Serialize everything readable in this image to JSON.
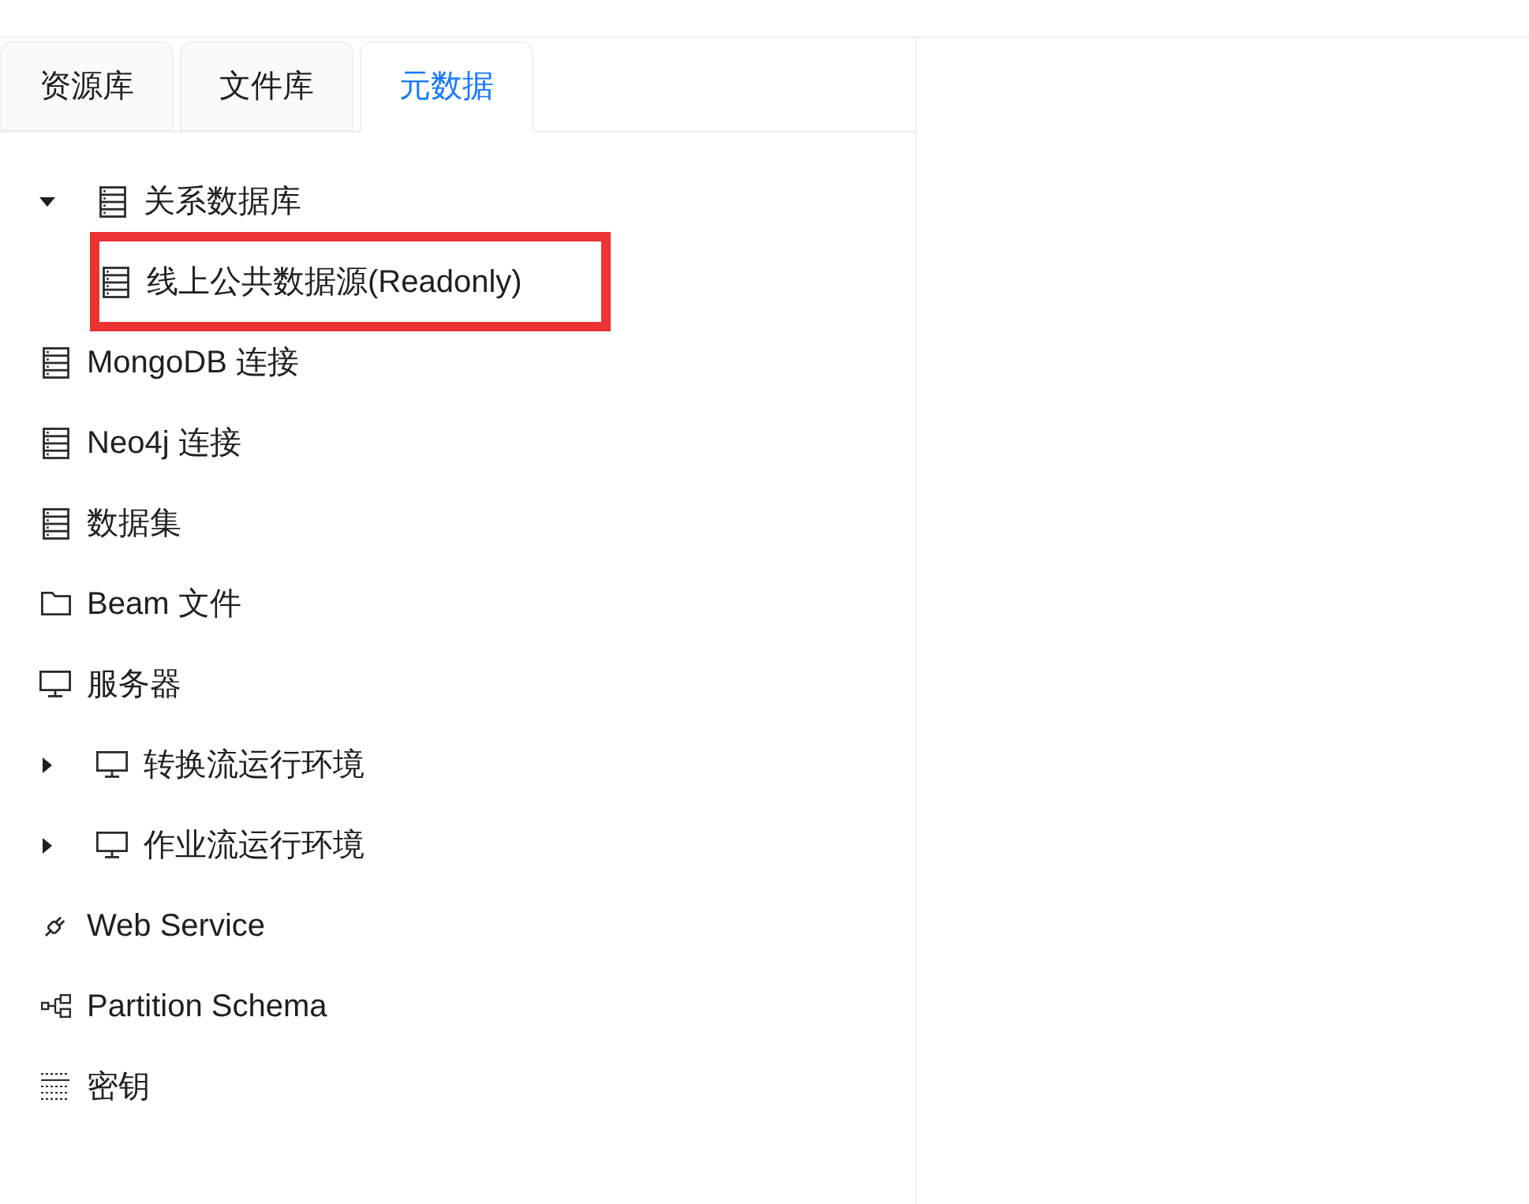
{
  "tabs": [
    {
      "label": "资源库",
      "selected": false
    },
    {
      "label": "文件库",
      "selected": false
    },
    {
      "label": "元数据",
      "selected": true
    }
  ],
  "tree": [
    {
      "label": "关系数据库",
      "kind": "database",
      "expanded": true,
      "annotated": false,
      "children": [
        {
          "label": "线上公共数据源(Readonly)",
          "kind": "database",
          "annotated": true
        }
      ]
    },
    {
      "label": "MongoDB 连接",
      "kind": "database",
      "annotated": false
    },
    {
      "label": "Neo4j 连接",
      "kind": "database",
      "annotated": false
    },
    {
      "label": "数据集",
      "kind": "database",
      "annotated": false
    },
    {
      "label": "Beam 文件",
      "kind": "folder",
      "annotated": false
    },
    {
      "label": "服务器",
      "kind": "server",
      "annotated": false
    },
    {
      "label": "转换流运行环境",
      "kind": "server",
      "expanded": false,
      "annotated": false
    },
    {
      "label": "作业流运行环境",
      "kind": "server",
      "expanded": false,
      "annotated": false
    },
    {
      "label": "Web Service",
      "kind": "web-service",
      "annotated": false
    },
    {
      "label": "Partition Schema",
      "kind": "partition",
      "annotated": false
    },
    {
      "label": "密钥",
      "kind": "key",
      "annotated": false
    }
  ]
}
